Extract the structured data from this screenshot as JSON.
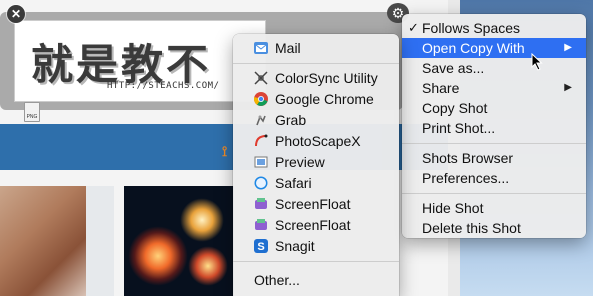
{
  "shot": {
    "headline": "就是教不",
    "url": "HTTP://STEACHS.COM/",
    "file_type": "PNG"
  },
  "main_menu": {
    "items": [
      {
        "label": "Follows Spaces",
        "checked": true
      },
      {
        "label": "Open Copy With",
        "submenu": true,
        "highlighted": true
      },
      {
        "label": "Save as..."
      },
      {
        "label": "Share",
        "submenu": true
      },
      {
        "label": "Copy Shot"
      },
      {
        "label": "Print Shot..."
      },
      {
        "label": "Shots Browser"
      },
      {
        "label": "Preferences..."
      },
      {
        "label": "Hide Shot"
      },
      {
        "label": "Delete this Shot"
      }
    ]
  },
  "open_with_menu": {
    "items": [
      {
        "label": "Mail",
        "icon": "mail-icon"
      },
      {
        "label": "ColorSync Utility",
        "icon": "colorsync-icon"
      },
      {
        "label": "Google Chrome",
        "icon": "chrome-icon"
      },
      {
        "label": "Grab",
        "icon": "grab-icon"
      },
      {
        "label": "PhotoScapeX",
        "icon": "photoscapex-icon"
      },
      {
        "label": "Preview",
        "icon": "preview-icon"
      },
      {
        "label": "Safari",
        "icon": "safari-icon"
      },
      {
        "label": "ScreenFloat",
        "icon": "screenfloat-icon"
      },
      {
        "label": "ScreenFloat",
        "icon": "screenfloat-icon"
      },
      {
        "label": "Snagit",
        "icon": "snagit-icon"
      },
      {
        "label": "Other...",
        "icon": ""
      }
    ]
  },
  "colors": {
    "highlight": "#2e6ff2",
    "page_bar": "#2e6fab"
  }
}
